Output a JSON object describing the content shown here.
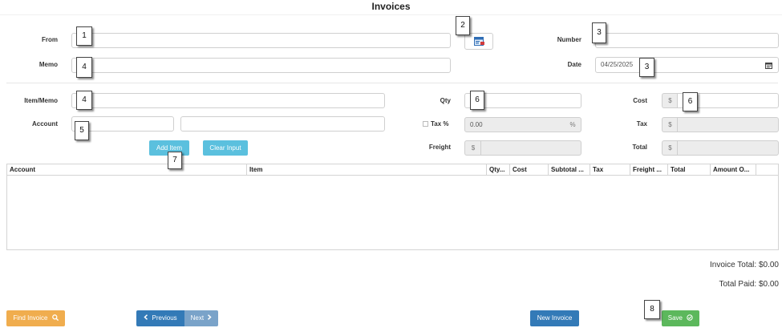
{
  "page": {
    "title": "Invoices"
  },
  "header": {
    "from_label": "From",
    "from_value": "",
    "memo_label": "Memo",
    "memo_value": "",
    "number_label": "Number",
    "number_value": "",
    "date_label": "Date",
    "date_value": "04/25/2025"
  },
  "item_form": {
    "item_memo_label": "Item/Memo",
    "account_label": "Account",
    "qty_label": "Qty",
    "tax_pct_label": "Tax %",
    "tax_pct_value": "0.00",
    "tax_pct_addon": "%",
    "freight_label": "Freight",
    "currency": "$",
    "cost_label": "Cost",
    "tax_label": "Tax",
    "total_label": "Total",
    "add_item_label": "Add Item",
    "clear_input_label": "Clear Input"
  },
  "grid": {
    "columns": [
      "Account",
      "Item",
      "Qty...",
      "Cost",
      "Subtotal ...",
      "Tax",
      "Freight ...",
      "Total",
      "Amount O..."
    ]
  },
  "totals": {
    "invoice_total": "Invoice Total: $0.00",
    "total_paid": "Total Paid: $0.00"
  },
  "footer": {
    "find_invoice_label": "Find Invoice",
    "previous_label": "Previous",
    "next_label": "Next",
    "new_invoice_label": "New Invoice",
    "save_label": "Save"
  },
  "markers": [
    "1",
    "2",
    "3",
    "4",
    "4",
    "5",
    "3",
    "6",
    "6",
    "7",
    "8"
  ],
  "colors": {
    "info": "#5bc0de",
    "primary": "#337ab7",
    "warning": "#f0ad4e",
    "success": "#5cb85c"
  }
}
